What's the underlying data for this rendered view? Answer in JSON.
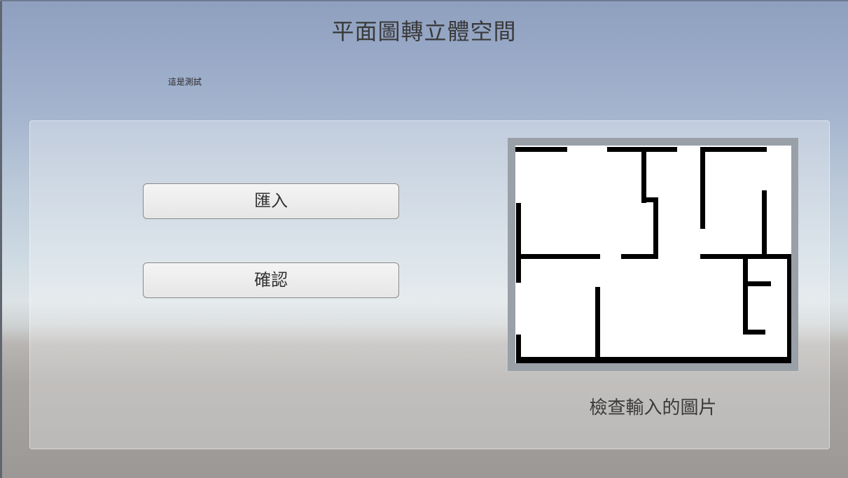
{
  "header": {
    "title": "平面圖轉立體空間",
    "test_label": "這是測試"
  },
  "actions": {
    "import_label": "匯入",
    "confirm_label": "確認"
  },
  "preview": {
    "caption": "檢查輸入的圖片"
  },
  "colors": {
    "panel_bg": "rgba(255,255,255,0.30)",
    "button_bg": "#eeeeee",
    "wall": "#000000",
    "text": "#333333"
  }
}
